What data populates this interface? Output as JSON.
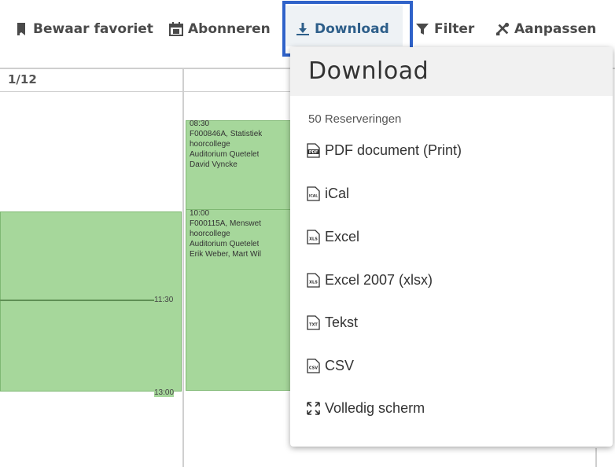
{
  "toolbar": {
    "items": [
      {
        "label": "Bewaar favoriet",
        "icon": "bookmark-icon"
      },
      {
        "label": "Abonneren",
        "icon": "calendar-icon"
      },
      {
        "label": "Download",
        "icon": "download-icon"
      },
      {
        "label": "Filter",
        "icon": "filter-icon"
      },
      {
        "label": "Aanpassen",
        "icon": "tools-icon"
      }
    ],
    "active_color": "#2e5f8a",
    "highlight_color": "#2f62c9"
  },
  "calendar": {
    "column_date": "1/12",
    "events": [
      {
        "time": "08:30",
        "lines": [
          "F000846A, Statistiek",
          "hoorcollege",
          "Auditorium Quetelet",
          "David Vyncke"
        ]
      },
      {
        "time": "10:00",
        "lines": [
          "F000115A, Menswet",
          "hoorcollege",
          "Auditorium Quetelet",
          "Erik Weber, Mart Wil"
        ]
      }
    ],
    "time_labels": [
      "11:30",
      "13:00"
    ],
    "event_color": "#a6d79b"
  },
  "dropdown": {
    "title": "Download",
    "count": "50 Reserveringen",
    "items": [
      {
        "label": "PDF document (Print)",
        "icon": "pdf-file-icon",
        "badge": "PDF"
      },
      {
        "label": "iCal",
        "icon": "ical-file-icon",
        "badge": "ICAL"
      },
      {
        "label": "Excel",
        "icon": "xls-file-icon",
        "badge": "XLS"
      },
      {
        "label": "Excel 2007 (xlsx)",
        "icon": "xlsx-file-icon",
        "badge": "XLS"
      },
      {
        "label": "Tekst",
        "icon": "txt-file-icon",
        "badge": "TXT"
      },
      {
        "label": "CSV",
        "icon": "csv-file-icon",
        "badge": "CSV"
      },
      {
        "label": "Volledig scherm",
        "icon": "fullscreen-icon"
      }
    ]
  }
}
